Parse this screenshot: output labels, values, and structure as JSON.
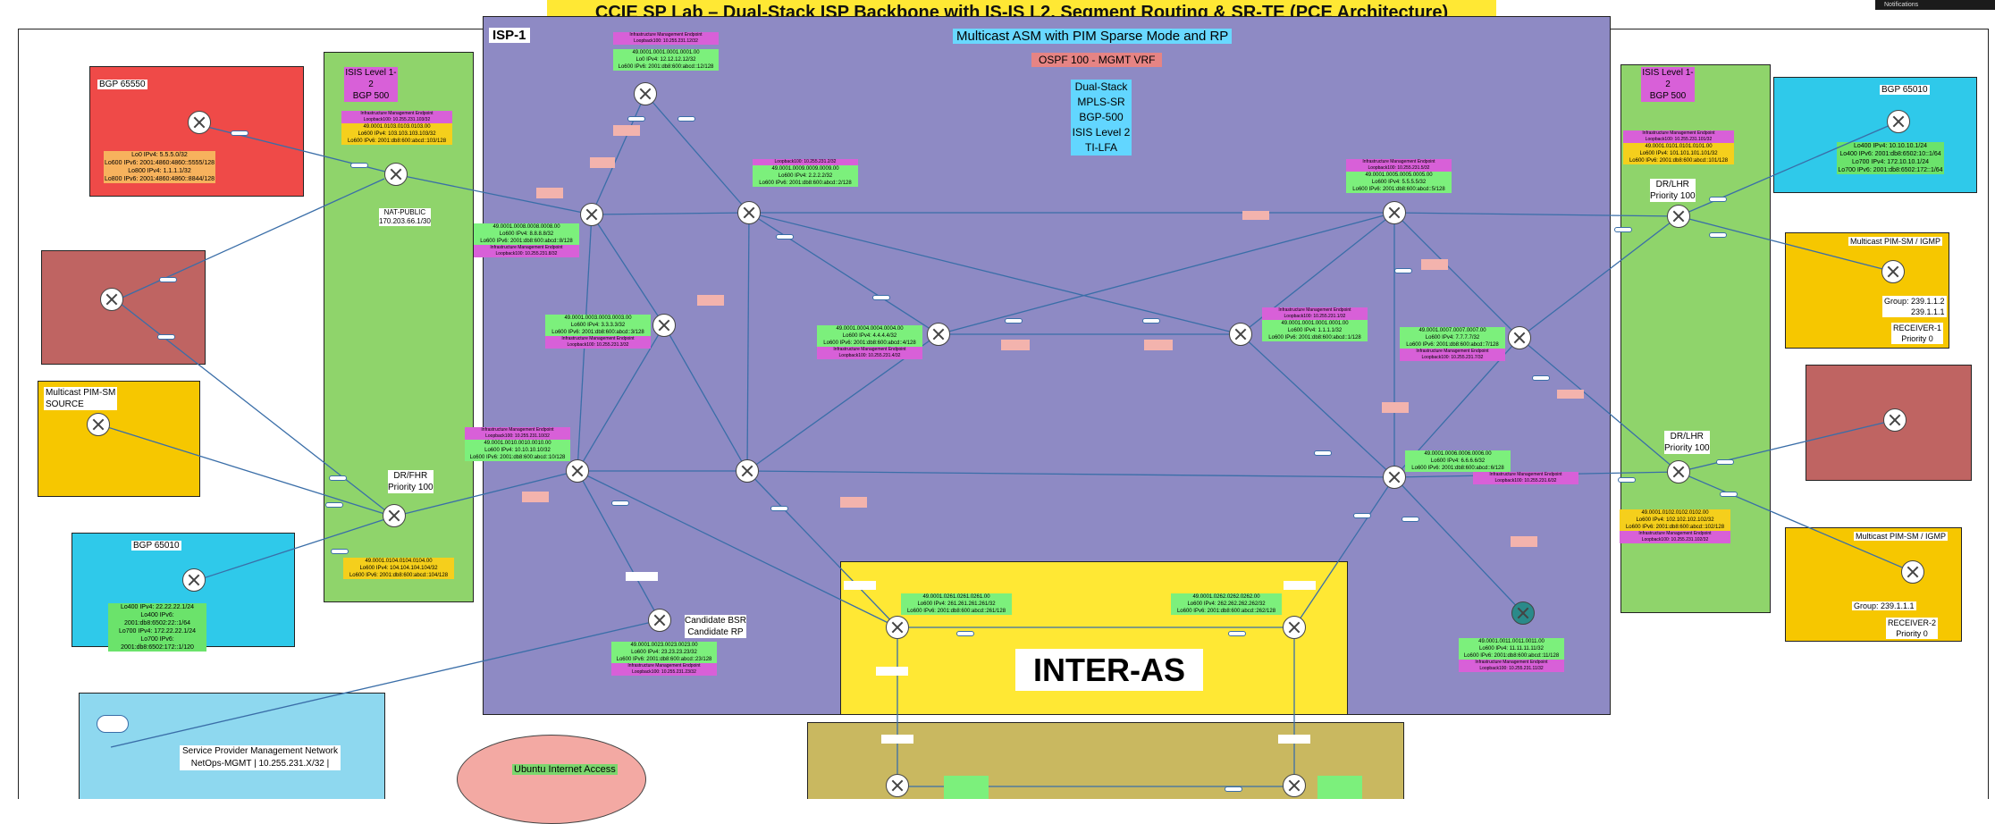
{
  "title": "CCIE SP  Lab – Dual-Stack ISP Backbone with IS-IS L2, Segment Routing & SR-TE (PCE Architecture)",
  "notifications_label": "Notifications",
  "isp": {
    "name": "ISP-1",
    "multicast_title": "Multicast ASM with PIM Sparse Mode and RP",
    "ospf_label": "OSPF 100 - MGMT VRF",
    "features": [
      "Dual-Stack",
      "MPLS-SR",
      "BGP-500",
      "ISIS Level 2",
      "TI-LFA"
    ]
  },
  "left_isis": {
    "l1": "ISIS Level 1-2",
    "l2": "BGP 500"
  },
  "right_isis": {
    "l1": "ISIS Level 1-2",
    "l2": "BGP 500"
  },
  "bgp_65550": {
    "title": "BGP 65550",
    "lines": [
      "Lo0 IPv4: 5.5.5.0/32",
      "Lo600 IPv6: 2001:4860:4860::5555/128",
      "Lo800 IPv4: 1.1.1.1/32",
      "Lo800 IPv6: 2001:4860:4860::8844/128"
    ]
  },
  "bgp_65010_left": {
    "title": "BGP 65010",
    "lines": [
      "Lo400 IPv4: 22.22.22.1/24",
      "Lo400 IPv6: 2001:db8:6502:22::1/64",
      "Lo700 IPv4: 172.22.22.1/24",
      "Lo700 IPv6: 2001:db8:6502:172::1/120"
    ]
  },
  "bgp_65010_right": {
    "title": "BGP 65010",
    "lines": [
      "Lo400 IPv4: 10.10.10.1/24",
      "Lo400 IPv6: 2001:db8:6502:10::1/64",
      "Lo700 IPv4: 172.10.10.1/24",
      "Lo700 IPv6: 2001:db8:6502:172::1/64"
    ]
  },
  "mcast_source": {
    "l1": "Multicast PIM-SM",
    "l2": "SOURCE"
  },
  "receiver1": {
    "title": "Multicast PIM-SM / IGMP",
    "group": "Group: 239.1.1.2",
    "group2": "239.1.1.1",
    "name": "RECEIVER-1",
    "priority": "Priority 0"
  },
  "receiver2": {
    "title": "Multicast PIM-SM / IGMP",
    "group": "Group: 239.1.1.1",
    "name": "RECEIVER-2",
    "priority": "Priority 0"
  },
  "nat_public": {
    "l1": "NAT-PUBLIC",
    "l2": "170.203.66.1/30"
  },
  "dr_fhr": {
    "l1": "DR/FHR",
    "l2": "Priority 100"
  },
  "dr_lhr_top": {
    "l1": "DR/LHR",
    "l2": "Priority 100"
  },
  "dr_lhr_bottom": {
    "l1": "DR/LHR",
    "l2": "Priority 100"
  },
  "candidate": {
    "l1": "Candidate BSR",
    "l2": "Candidate RP"
  },
  "inter_as": "INTER-AS",
  "mgmt": {
    "l1": "Service Provider Management Network",
    "l2": "NetOps-MGMT | 10.255.231.X/32 |"
  },
  "ubuntu": "Ubuntu Internet Access",
  "mgmt_endpoint": "Infrastructure Management Endpoint",
  "nodes": [
    {
      "id": "n1",
      "net": "49.0001.0001.0001.0001.00",
      "v4": "Lo0 IPv4: 12.12.12.12/32",
      "v6": "Lo600 IPv6: 2001:db8:600:abcd::12/128",
      "lb": "Loopback100: 10.255.231.12/32"
    },
    {
      "id": "n9",
      "net": "49.0001.0009.0009.0009.00",
      "v4": "Lo600 IPv4: 2.2.2.2/32",
      "v6": "Lo600 IPv6: 2001:db8:600:abcd::2/128",
      "lb": "Loopback100: 10.255.231.2/32"
    },
    {
      "id": "n8",
      "net": "49.0001.0008.0008.0008.00",
      "v4": "Lo600 IPv4: 8.8.8.8/32",
      "v6": "Lo600 IPv6: 2001:db8:600:abcd::8/128",
      "lb": "Loopback100: 10.255.231.8/32"
    },
    {
      "id": "n3",
      "net": "49.0001.0003.0003.0003.00",
      "v4": "Lo600 IPv4: 3.3.3.3/32",
      "v6": "Lo600 IPv6: 2001:db8:600:abcd::3/128",
      "lb": "Loopback100: 10.255.231.3/32"
    },
    {
      "id": "n4",
      "net": "49.0001.0004.0004.0004.00",
      "v4": "Lo600 IPv4: 4.4.4.4/32",
      "v6": "Lo600 IPv6: 2001:db8:600:abcd::4/128",
      "lb": "Loopback100: 10.255.231.4/32"
    },
    {
      "id": "n10",
      "net": "49.0001.0010.0010.0010.00",
      "v4": "Lo600 IPv4: 10.10.10.10/32",
      "v6": "Lo600 IPv6: 2001:db8:600:abcd::10/128",
      "lb": "Loopback100: 10.255.231.10/32"
    },
    {
      "id": "n5",
      "net": "49.0001.0005.0005.0005.00",
      "v4": "Lo600 IPv4: 5.5.5.5/32",
      "v6": "Lo600 IPv6: 2001:db8:600:abcd::5/128",
      "lb": "Loopback100: 10.255.231.5/32"
    },
    {
      "id": "n1b",
      "net": "49.0001.0001.0001.0001.00",
      "v4": "Lo600 IPv4: 1.1.1.1/32",
      "v6": "Lo600 IPv6: 2001:db8:600:abcd::1/128",
      "lb": "Loopback100: 10.255.231.1/32"
    },
    {
      "id": "n7",
      "net": "49.0001.0007.0007.0007.00",
      "v4": "Lo600 IPv4: 7.7.7.7/32",
      "v6": "Lo600 IPv6: 2001:db8:600:abcd::7/128",
      "lb": "Loopback100: 10.255.231.7/32"
    },
    {
      "id": "n6",
      "net": "49.0001.0006.0006.0006.00",
      "v4": "Lo600 IPv4: 6.6.6.6/32",
      "v6": "Lo600 IPv6: 2001:db8:600:abcd::6/128",
      "lb": "Loopback100: 10.255.231.6/32"
    },
    {
      "id": "n11",
      "net": "49.0001.0011.0011.0011.00",
      "v4": "Lo600 IPv4: 11.11.11.11/32",
      "v6": "Lo600 IPv6: 2001:db8:600:abcd::11/128",
      "lb": "Loopback100: 10.255.231.11/32"
    },
    {
      "id": "n23",
      "net": "49.0001.0023.0023.0023.00",
      "v4": "Lo600 IPv4: 23.23.23.23/32",
      "v6": "Lo600 IPv6: 2001:db8:600:abcd::23/128",
      "lb": "Loopback100: 10.255.231.23/32"
    },
    {
      "id": "n101",
      "net": "49.0001.0101.0101.0101.00",
      "v4": "Lo600 IPv4: 101.101.101.101/32",
      "v6": "Lo600 IPv6: 2001:db8:600:abcd::101/128",
      "lb": "Loopback100: 10.255.231.101/32"
    },
    {
      "id": "n102",
      "net": "49.0001.0102.0102.0102.00",
      "v4": "Lo600 IPv4: 102.102.102.102/32",
      "v6": "Lo600 IPv6: 2001:db8:600:abcd::102/128",
      "lb": "Loopback100: 10.255.231.102/32"
    },
    {
      "id": "n103",
      "net": "49.0001.0103.0103.0103.00",
      "v4": "Lo600 IPv4: 103.103.103.103/32",
      "v6": "Lo600 IPv6: 2001:db8:600:abcd::103/128",
      "lb": "Loopback100: 10.255.231.103/32"
    },
    {
      "id": "n104",
      "net": "49.0001.0104.0104.0104.00",
      "v4": "Lo600 IPv4: 104.104.104.104/32",
      "v6": "Lo600 IPv6: 2001:db8:600:abcd::104/128",
      "lb": "Loopback100: 10.255.231.104/32"
    },
    {
      "id": "n261",
      "net": "49.0001.0261.0261.0261.00",
      "v4": "Lo600 IPv4: 261.261.261.261/32",
      "v6": "Lo600 IPv6: 2001:db8:600:abcd::261/128",
      "lb": ""
    },
    {
      "id": "n262",
      "net": "49.0001.0262.0262.0262.00",
      "v4": "Lo600 IPv4: 262.262.262.262/32",
      "v6": "Lo600 IPv6: 2001:db8:600:abcd::262/128",
      "lb": ""
    }
  ]
}
